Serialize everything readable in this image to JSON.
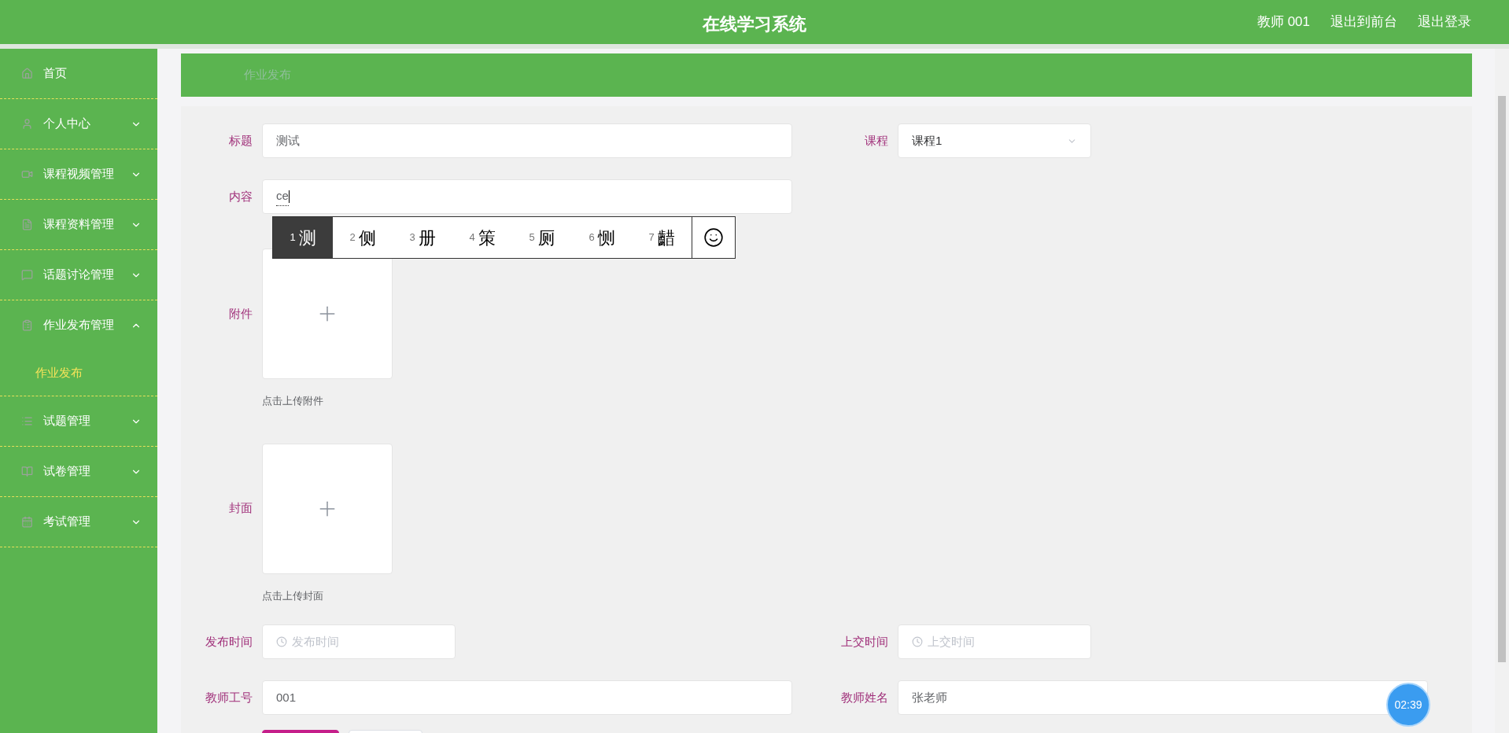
{
  "header": {
    "title": "在线学习系统",
    "links": [
      "教师 001",
      "退出到前台",
      "退出登录"
    ]
  },
  "sidebar": {
    "items": [
      {
        "label": "首页",
        "kind": "link"
      },
      {
        "label": "个人中心",
        "kind": "menu",
        "expanded": false
      },
      {
        "label": "课程视频管理",
        "kind": "menu",
        "expanded": false
      },
      {
        "label": "课程资料管理",
        "kind": "menu",
        "expanded": false
      },
      {
        "label": "话题讨论管理",
        "kind": "menu",
        "expanded": false
      },
      {
        "label": "作业发布管理",
        "kind": "menu",
        "expanded": true,
        "children": [
          {
            "label": "作业发布",
            "selected": true
          }
        ]
      },
      {
        "label": "试题管理",
        "kind": "menu",
        "expanded": false
      },
      {
        "label": "试卷管理",
        "kind": "menu",
        "expanded": false
      },
      {
        "label": "考试管理",
        "kind": "menu",
        "expanded": false
      }
    ]
  },
  "breadcrumb": "作业发布",
  "form": {
    "rows": [
      {
        "fields": [
          {
            "kind": "text",
            "label": "标题",
            "value": "测试",
            "wide": true
          },
          {
            "kind": "select",
            "label": "课程",
            "value": "课程1"
          }
        ]
      },
      {
        "fields": [
          {
            "kind": "composing",
            "label": "内容",
            "value": "ce",
            "wide": true
          }
        ]
      },
      {
        "fields": [
          {
            "kind": "upload",
            "label": "附件",
            "hint": "点击上传附件"
          }
        ]
      },
      {
        "fields": [
          {
            "kind": "upload",
            "label": "封面",
            "hint": "点击上传封面"
          }
        ]
      },
      {
        "fields": [
          {
            "kind": "date",
            "label": "发布时间",
            "placeholder": "发布时间"
          },
          {
            "kind": "date",
            "label": "上交时间",
            "placeholder": "上交时间"
          }
        ]
      },
      {
        "fields": [
          {
            "kind": "text",
            "label": "教师工号",
            "value": "001",
            "wide": true
          },
          {
            "kind": "text",
            "label": "教师姓名",
            "value": "张老师",
            "wide": true
          }
        ]
      }
    ],
    "buttons": [
      {
        "kind": "primary"
      },
      {
        "kind": "default"
      }
    ]
  },
  "ime": {
    "candidates": [
      {
        "index": "1",
        "char": "测",
        "selected": true
      },
      {
        "index": "2",
        "char": "侧",
        "selected": false
      },
      {
        "index": "3",
        "char": "册",
        "selected": false
      },
      {
        "index": "4",
        "char": "策",
        "selected": false
      },
      {
        "index": "5",
        "char": "厕",
        "selected": false
      },
      {
        "index": "6",
        "char": "恻",
        "selected": false
      },
      {
        "index": "7",
        "char": "齰",
        "selected": false
      }
    ]
  },
  "timer": "02:39"
}
